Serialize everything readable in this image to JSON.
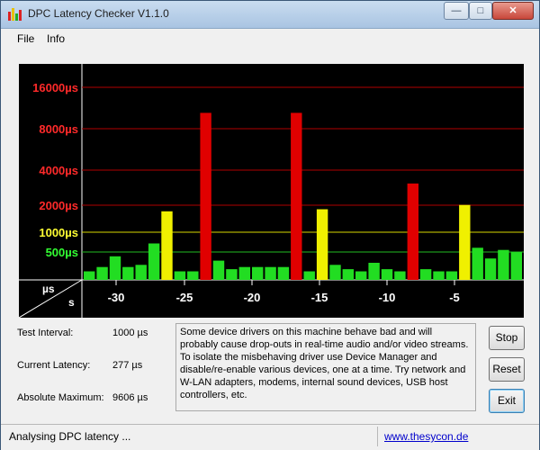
{
  "window": {
    "title": "DPC Latency Checker V1.1.0"
  },
  "titlebar_buttons": {
    "minimize": "—",
    "maximize": "□",
    "close": "✕"
  },
  "menu": [
    {
      "label": "File"
    },
    {
      "label": "Info"
    }
  ],
  "chart_data": {
    "type": "bar",
    "y_tick_labels": [
      "16000µs",
      "8000µs",
      "4000µs",
      "2000µs",
      "1000µs",
      "500µs"
    ],
    "y_tick_colors": [
      "#ff2a2a",
      "#ff2a2a",
      "#ff2a2a",
      "#ff2a2a",
      "#ffff33",
      "#33ff33"
    ],
    "x_ticks": [
      "-30",
      "-25",
      "-20",
      "-15",
      "-10",
      "-5"
    ],
    "corner_top": "µs",
    "corner_bottom": "s",
    "bar_heights_fraction": [
      0.04,
      0.06,
      0.11,
      0.06,
      0.07,
      0.17,
      0.32,
      0.04,
      0.04,
      0.78,
      0.09,
      0.05,
      0.06,
      0.06,
      0.06,
      0.06,
      0.78,
      0.04,
      0.33,
      0.07,
      0.05,
      0.04,
      0.08,
      0.05,
      0.04,
      0.45,
      0.05,
      0.04,
      0.04,
      0.35,
      0.15,
      0.1,
      0.14,
      0.13
    ],
    "bar_colors": [
      "#22dd22",
      "#22dd22",
      "#22dd22",
      "#22dd22",
      "#22dd22",
      "#22dd22",
      "#f0f000",
      "#22dd22",
      "#22dd22",
      "#e00000",
      "#22dd22",
      "#22dd22",
      "#22dd22",
      "#22dd22",
      "#22dd22",
      "#22dd22",
      "#e00000",
      "#22dd22",
      "#f0f000",
      "#22dd22",
      "#22dd22",
      "#22dd22",
      "#22dd22",
      "#22dd22",
      "#22dd22",
      "#e00000",
      "#22dd22",
      "#22dd22",
      "#22dd22",
      "#f0f000",
      "#22dd22",
      "#22dd22",
      "#22dd22",
      "#22dd22"
    ]
  },
  "stats": {
    "test_interval_label": "Test Interval:",
    "test_interval_value": "1000 µs",
    "current_latency_label": "Current Latency:",
    "current_latency_value": "277 µs",
    "absolute_max_label": "Absolute Maximum:",
    "absolute_max_value": "9606 µs"
  },
  "info_text": "Some device drivers on this machine behave bad and will probably cause drop-outs in real-time audio and/or video streams. To isolate the misbehaving driver use Device Manager and disable/re-enable various devices, one at a time. Try network and W-LAN adapters, modems, internal sound devices, USB host controllers, etc.",
  "buttons": {
    "stop": "Stop",
    "reset": "Reset",
    "exit": "Exit"
  },
  "status": {
    "text": "Analysing DPC latency ...",
    "link": "www.thesycon.de"
  }
}
